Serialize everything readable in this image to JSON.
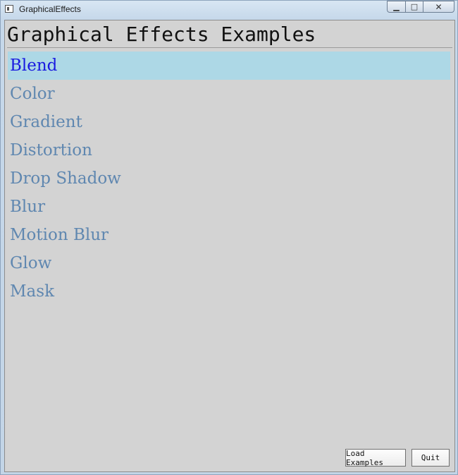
{
  "window": {
    "title": "GraphicalEffects",
    "controls": {
      "minimize": "▁",
      "maximize": "□",
      "close": "✕"
    }
  },
  "main": {
    "heading": "Graphical Effects Examples",
    "items": [
      {
        "label": "Blend",
        "selected": true
      },
      {
        "label": "Color",
        "selected": false
      },
      {
        "label": "Gradient",
        "selected": false
      },
      {
        "label": "Distortion",
        "selected": false
      },
      {
        "label": "Drop Shadow",
        "selected": false
      },
      {
        "label": "Blur",
        "selected": false
      },
      {
        "label": "Motion Blur",
        "selected": false
      },
      {
        "label": "Glow",
        "selected": false
      },
      {
        "label": "Mask",
        "selected": false
      }
    ]
  },
  "footer": {
    "load_label": "Load Examples",
    "quit_label": "Quit"
  },
  "colors": {
    "selected_bg": "#add8e6",
    "selected_text": "#1a1ae0",
    "item_text": "#5f87b0",
    "client_bg": "#d3d3d3"
  }
}
